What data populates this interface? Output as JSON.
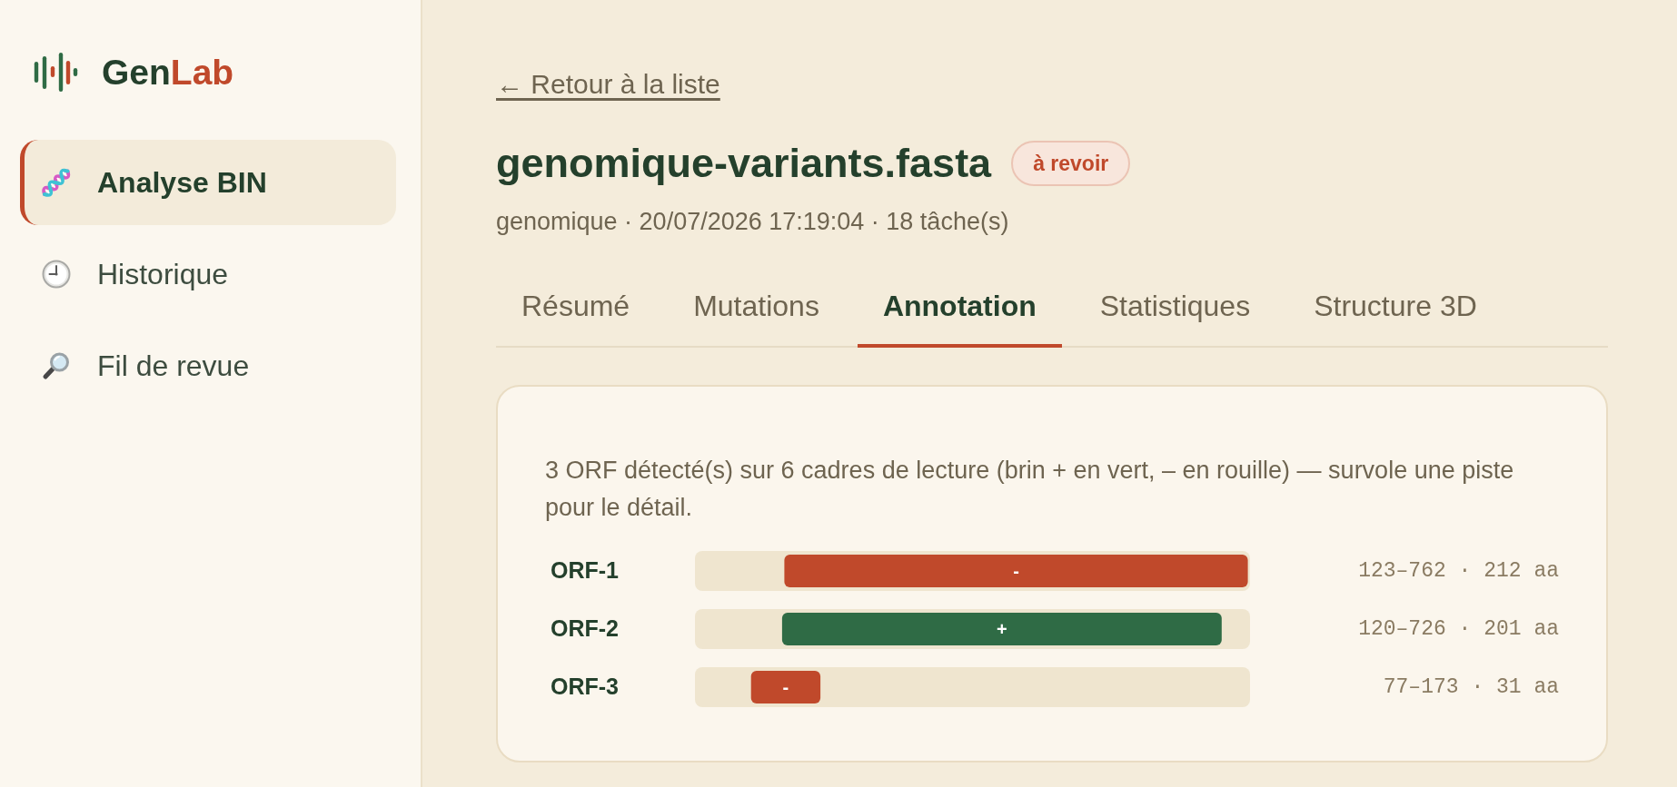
{
  "sidebar": {
    "logo_text": [
      {
        "text": "Gen",
        "color": "#24402c"
      },
      {
        "text": "Lab",
        "color": "#c0492b"
      }
    ],
    "items": [
      {
        "label": "Analyse BIN",
        "selected": true
      },
      {
        "label": "Historique",
        "selected": false
      },
      {
        "label": "Fil de revue",
        "selected": false
      }
    ]
  },
  "header": {
    "back_link": "← Retour à la liste",
    "title": "genomique-variants.fasta",
    "status_badge": "à revoir",
    "meta": "genomique · 20/07/2026 17:19:04 · 18 tâche(s)"
  },
  "tabs": [
    {
      "label": "Résumé",
      "selected": false
    },
    {
      "label": "Mutations",
      "selected": false
    },
    {
      "label": "Annotation",
      "selected": true
    },
    {
      "label": "Statistiques",
      "selected": false
    },
    {
      "label": "Structure 3D",
      "selected": false
    }
  ],
  "annotation_card": {
    "description": "3 ORF détecté(s) sur 6 cadres de lecture (brin + en vert, – en rouille) — survole une piste pour le détail.",
    "orfs": [
      {
        "label": "ORF-1",
        "strand": "-",
        "color": "#c0492b",
        "range": "123–762 · 212 aa"
      },
      {
        "label": "ORF-2",
        "strand": "+",
        "color": "#2f6b45",
        "range": "120–726 · 201 aa"
      },
      {
        "label": "ORF-3",
        "strand": "-",
        "color": "#c0492b",
        "range": "77–173 · 31 aa"
      }
    ]
  }
}
